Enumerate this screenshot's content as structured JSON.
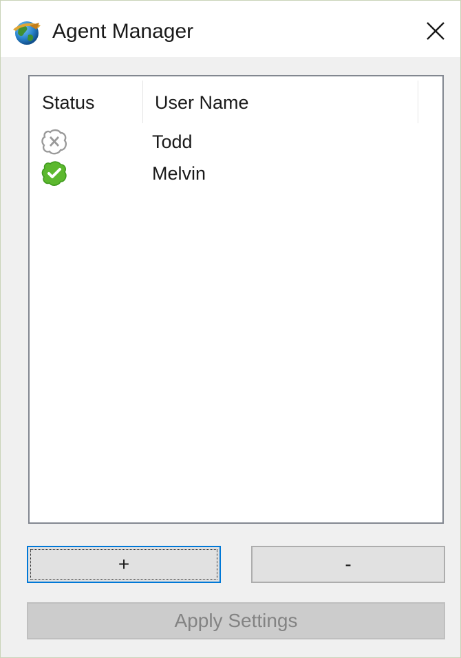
{
  "window": {
    "title": "Agent Manager",
    "close_glyph": "✕"
  },
  "list": {
    "columns": [
      "Status",
      "User Name"
    ],
    "rows": [
      {
        "status_icon": "offline-status-icon",
        "user_name": "Todd"
      },
      {
        "status_icon": "online-status-icon",
        "user_name": "Melvin"
      }
    ]
  },
  "buttons": {
    "add_label": "+",
    "remove_label": "-",
    "apply_label": "Apply Settings"
  },
  "colors": {
    "online": "#5cb82e",
    "offline": "#9a9a9a",
    "focus": "#0078d7"
  }
}
